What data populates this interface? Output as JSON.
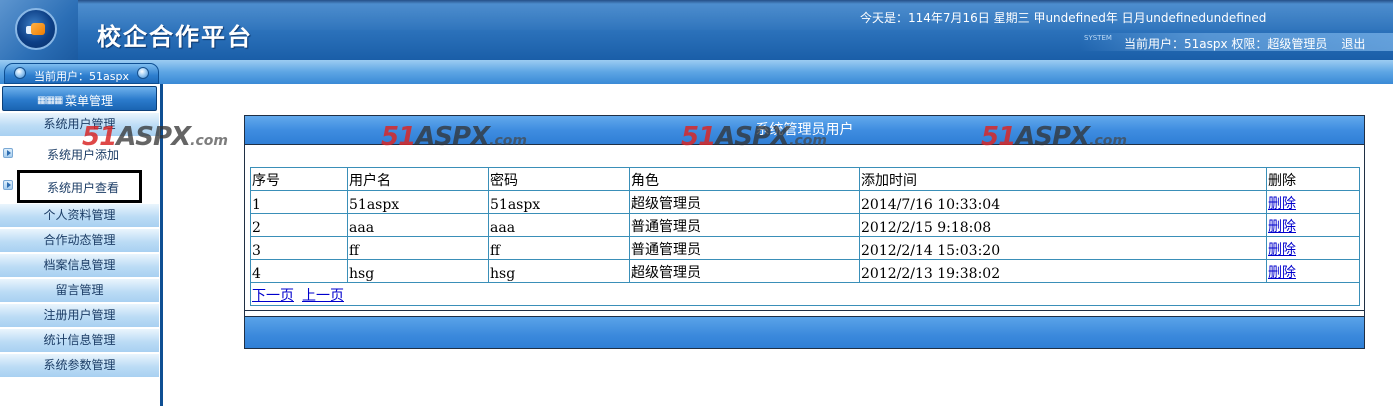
{
  "header": {
    "title": "校企合作平台",
    "date_line": "今天是：114年7月16日 星期三 甲undefined年 日月undefinedundefined",
    "system_tag": "SYSTEM",
    "user_info": "当前用户：51aspx 权限：超级管理员",
    "logout": "退出"
  },
  "subbar": {
    "current_user": "当前用户：51aspx"
  },
  "menu": {
    "header": "菜单管理",
    "header_icon": "grid-icon",
    "items": [
      {
        "label": "系统用户管理"
      },
      {
        "label": "系统用户添加"
      },
      {
        "label": "系统用户查看"
      },
      {
        "label": "个人资料管理"
      },
      {
        "label": "合作动态管理"
      },
      {
        "label": "档案信息管理"
      },
      {
        "label": "留言管理"
      },
      {
        "label": "注册用户管理"
      },
      {
        "label": "统计信息管理"
      },
      {
        "label": "系统参数管理"
      }
    ]
  },
  "watermark": {
    "num": "51",
    "brand": "ASPX",
    "domain": ".com"
  },
  "panel": {
    "title": "系统管理员用户",
    "columns": [
      "序号",
      "用户名",
      "密码",
      "角色",
      "添加时间",
      "删除"
    ],
    "rows": [
      [
        "1",
        "51aspx",
        "51aspx",
        "超级管理员",
        "2014/7/16 10:33:04",
        "删除"
      ],
      [
        "2",
        "aaa",
        "aaa",
        "普通管理员",
        "2012/2/15 9:18:08",
        "删除"
      ],
      [
        "3",
        "ff",
        "ff",
        "普通管理员",
        "2012/2/14 15:03:20",
        "删除"
      ],
      [
        "4",
        "hsg",
        "hsg",
        "超级管理员",
        "2012/2/13 19:38:02",
        "删除"
      ]
    ],
    "pager": {
      "next": "下一页",
      "prev": "上一页"
    }
  },
  "colors": {
    "header_blue": "#2c72bb",
    "panel_blue": "#3f8de0",
    "table_border": "#3a8fb8",
    "link": "#0000cc"
  }
}
